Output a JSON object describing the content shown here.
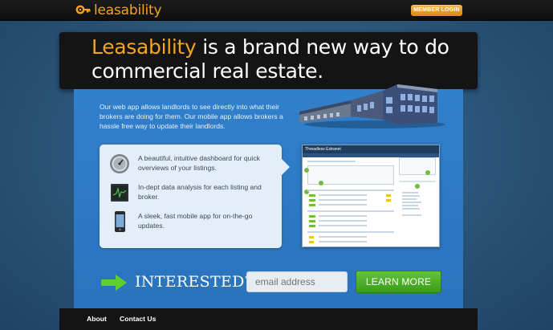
{
  "header": {
    "logo_text": "leasability",
    "member_login": "MEMBER LOGIN"
  },
  "hero": {
    "brand": "Leasability",
    "tagline": " is a brand new way to do commercial real estate."
  },
  "intro": {
    "text": "Our web app allows landlords to see directly into what their brokers are doing for them. Our mobile app allows brokers a hassle free way to update their landlords."
  },
  "features": [
    {
      "icon": "gauge-icon",
      "text": "A beautiful, intuitive dashboard for quick overviews of your listings."
    },
    {
      "icon": "chart-monitor-icon",
      "text": "In-dept data analysis for each listing and broker."
    },
    {
      "icon": "smartphone-icon",
      "text": "A sleek, fast mobile app for on-the-go updates."
    }
  ],
  "dashboard": {
    "title": "Threadless Extranet"
  },
  "signup": {
    "interested": "INTERESTED?",
    "email_placeholder": "email address",
    "learn_more": "LEARN MORE"
  },
  "footer": {
    "about": "About",
    "contact": "Contact Us"
  },
  "colors": {
    "accent": "#f4a51c",
    "panel": "#3180cc",
    "cta": "#4aae28"
  }
}
